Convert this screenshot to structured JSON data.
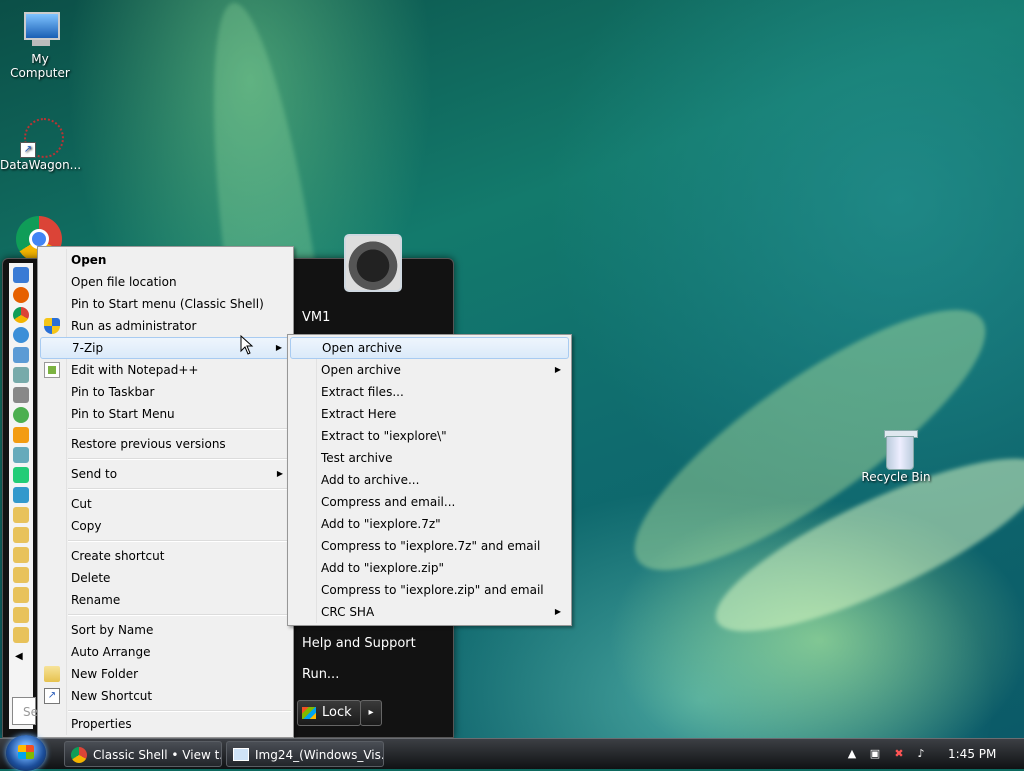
{
  "desktop": {
    "icons": [
      {
        "label": "My Computer",
        "icon": "computer-icon"
      },
      {
        "label": "DataWagon...",
        "icon": "datawagon-icon"
      },
      {
        "label": "Recycle Bin",
        "icon": "recycle-bin-icon"
      }
    ]
  },
  "start_menu": {
    "user_name": "VM1",
    "help": "Help and Support",
    "run": "Run...",
    "lock": "Lock",
    "lock_arrow": "▸",
    "search_placeholder": "Se"
  },
  "context_menu": {
    "items": {
      "open": "Open",
      "open_location": "Open file location",
      "pin_start_classic": "Pin to Start menu (Classic Shell)",
      "run_admin": "Run as administrator",
      "seven_zip": "7-Zip",
      "edit_notepad": "Edit with Notepad++",
      "pin_taskbar": "Pin to Taskbar",
      "pin_start": "Pin to Start Menu",
      "restore": "Restore previous versions",
      "send_to": "Send to",
      "cut": "Cut",
      "copy": "Copy",
      "create_shortcut": "Create shortcut",
      "delete": "Delete",
      "rename": "Rename",
      "sort_name": "Sort by Name",
      "auto_arrange": "Auto Arrange",
      "new_folder": "New Folder",
      "new_shortcut": "New Shortcut",
      "properties": "Properties"
    }
  },
  "submenu_7zip": {
    "items": {
      "open_archive": "Open archive",
      "open_archive_sub": "Open archive",
      "extract_files": "Extract files...",
      "extract_here": "Extract Here",
      "extract_to": "Extract to \"iexplore\\\"",
      "test_archive": "Test archive",
      "add_archive": "Add to archive...",
      "compress_email": "Compress and email...",
      "add_7z": "Add to \"iexplore.7z\"",
      "compress_7z_email": "Compress to \"iexplore.7z\" and email",
      "add_zip": "Add to \"iexplore.zip\"",
      "compress_zip_email": "Compress to \"iexplore.zip\" and email",
      "crc_sha": "CRC SHA"
    }
  },
  "taskbar": {
    "tasks": [
      {
        "label": "Classic Shell • View t...",
        "icon": "chrome-icon"
      },
      {
        "label": "Img24_(Windows_Vis...",
        "icon": "window-icon"
      }
    ],
    "clock": "1:45 PM"
  },
  "colors": {
    "menu_bg": "#f0f0f0",
    "highlight_border": "#a8cbf1",
    "start_menu_bg": "#121212"
  }
}
